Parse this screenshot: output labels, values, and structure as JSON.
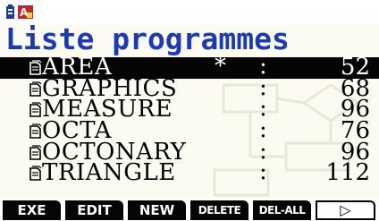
{
  "header": {
    "title": "Liste programmes"
  },
  "status_bar": {
    "icons": [
      "battery-icon",
      "alpha-mode-icon"
    ]
  },
  "programs": [
    {
      "name": "AREA",
      "marker": "*",
      "separator": ":",
      "size": "52",
      "selected": true
    },
    {
      "name": "GRAPHICS",
      "marker": "",
      "separator": ":",
      "size": "68",
      "selected": false
    },
    {
      "name": "MEASURE",
      "marker": "",
      "separator": ":",
      "size": "96",
      "selected": false
    },
    {
      "name": "OCTA",
      "marker": "",
      "separator": ":",
      "size": "76",
      "selected": false
    },
    {
      "name": "OCTONARY",
      "marker": "",
      "separator": ":",
      "size": "96",
      "selected": false
    },
    {
      "name": "TRIANGLE",
      "marker": "",
      "separator": ":",
      "size": "112",
      "selected": false
    }
  ],
  "function_keys": [
    {
      "label": "EXE"
    },
    {
      "label": "EDIT"
    },
    {
      "label": "NEW"
    },
    {
      "label": "DELETE"
    },
    {
      "label": "DEL-ALL"
    },
    {
      "label": "▷"
    }
  ],
  "colors": {
    "title": "#1a3ab8",
    "selection": "#050505",
    "background": "#fbfbf2"
  }
}
